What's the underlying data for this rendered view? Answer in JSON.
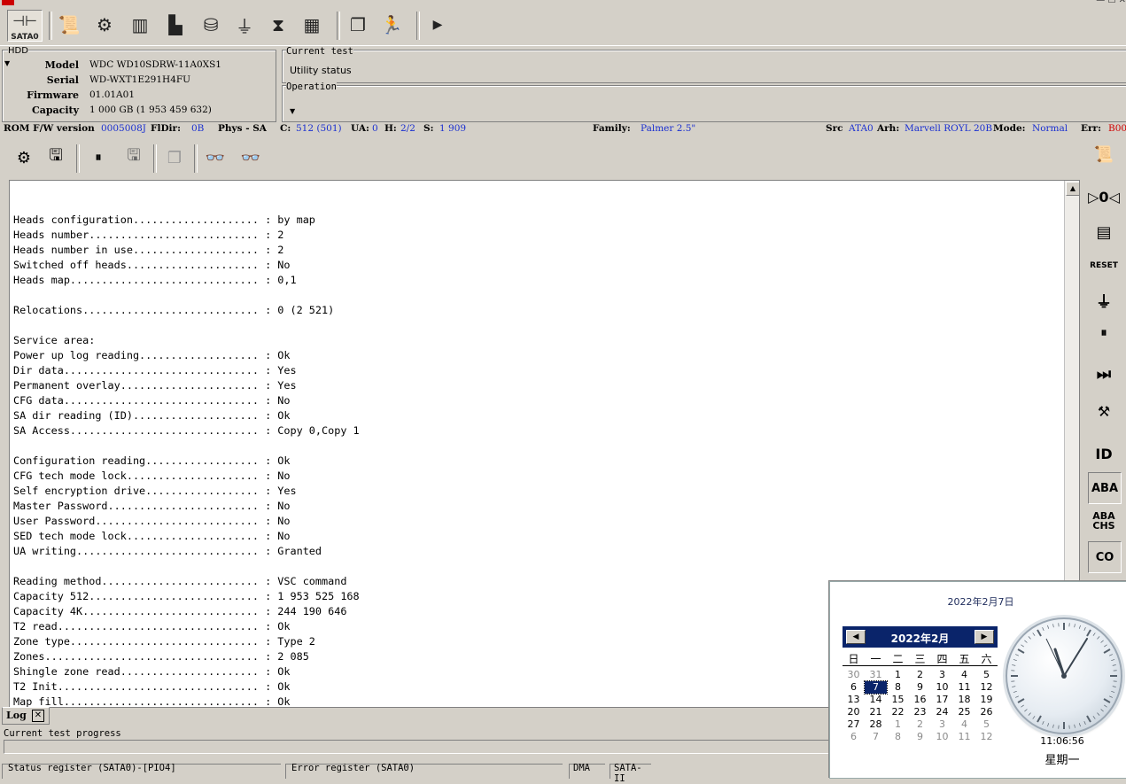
{
  "toolbar": {
    "sata_label": "SATA0"
  },
  "hdd": {
    "legend": "HDD",
    "rows": [
      {
        "label": "Model",
        "value": "WDC WD10SDRW-11A0XS1"
      },
      {
        "label": "Serial",
        "value": "WD-WXT1E291H4FU"
      },
      {
        "label": "Firmware",
        "value": "01.01A01"
      },
      {
        "label": "Capacity",
        "value": "1 000 GB (1 953 459 632)"
      }
    ]
  },
  "current_test": {
    "legend": "Current test",
    "value": "Utility status"
  },
  "operation": {
    "legend": "Operation",
    "value": ""
  },
  "infoline": {
    "rom_label": "ROM F/W version",
    "rom_value": "0005008J",
    "fldir_label": "FlDir:",
    "fldir_value": "0B",
    "phys_label": "Phys - SA",
    "c_label": "C:",
    "c_value": "512 (501)",
    "ua_label": "UA:",
    "ua_value": "0",
    "h_label": "H:",
    "h_value": "2/2",
    "s_label": "S:",
    "s_value": "1 909",
    "family_label": "Family:",
    "family_value": "Palmer 2.5\"",
    "src_label": "Src",
    "src_value": "ATA0",
    "arh_label": "Arh:",
    "arh_value": "Marvell ROYL 20B",
    "mode_label": "Mode:",
    "mode_value": "Normal",
    "err_label": "Err:",
    "err_value": "B00"
  },
  "report": [
    "",
    "Heads configuration.................... : by map",
    "Heads number........................... : 2",
    "Heads number in use.................... : 2",
    "Switched off heads..................... : No",
    "Heads map.............................. : 0,1",
    "",
    "Relocations............................ : 0 (2 521)",
    "",
    "Service area:",
    "Power up log reading................... : Ok",
    "Dir data............................... : Yes",
    "Permanent overlay...................... : Yes",
    "CFG data............................... : No",
    "SA dir reading (ID).................... : Ok",
    "SA Access.............................. : Copy 0,Copy 1",
    "",
    "Configuration reading.................. : Ok",
    "CFG tech mode lock..................... : No",
    "Self encryption drive.................. : Yes",
    "Master Password........................ : No",
    "User Password.......................... : No",
    "SED tech mode lock..................... : No",
    "UA writing............................. : Granted",
    "",
    "Reading method......................... : VSC command",
    "Capacity 512........................... : 1 953 525 168",
    "Capacity 4K............................ : 244 190 646",
    "T2 read................................ : Ok",
    "Zone type.............................. : Type 2",
    "Zones.................................. : 2 085",
    "Shingle zone read...................... : Ok",
    "T2 Init................................ : Ok",
    "Map fill............................... : Ok"
  ],
  "sidebar": {
    "id_label": "ID",
    "aba_label": "ABA",
    "abachs_label": "ABA CHS",
    "co_label": "CO"
  },
  "bottom": {
    "log_tab": "Log",
    "progress_label": "Current test progress",
    "status_register": "Status register (SATA0)-[PIO4]",
    "error_register": "Error register (SATA0)",
    "dma": "DMA",
    "sata": "SATA-II"
  },
  "calendar": {
    "date_text": "2022年2月7日",
    "month_title": "2022年2月",
    "weekdays": [
      "日",
      "一",
      "二",
      "三",
      "四",
      "五",
      "六"
    ],
    "days": [
      [
        "30",
        "31",
        "1",
        "2",
        "3",
        "4",
        "5"
      ],
      [
        "6",
        "7",
        "8",
        "9",
        "10",
        "11",
        "12"
      ],
      [
        "13",
        "14",
        "15",
        "16",
        "17",
        "18",
        "19"
      ],
      [
        "20",
        "21",
        "22",
        "23",
        "24",
        "25",
        "26"
      ],
      [
        "27",
        "28",
        "1",
        "2",
        "3",
        "4",
        "5"
      ],
      [
        "6",
        "7",
        "8",
        "9",
        "10",
        "11",
        "12"
      ]
    ],
    "gray_cells": [
      [
        0,
        0
      ],
      [
        0,
        1
      ],
      [
        4,
        2
      ],
      [
        4,
        3
      ],
      [
        4,
        4
      ],
      [
        4,
        5
      ],
      [
        4,
        6
      ],
      [
        5,
        0
      ],
      [
        5,
        1
      ],
      [
        5,
        2
      ],
      [
        5,
        3
      ],
      [
        5,
        4
      ],
      [
        5,
        5
      ],
      [
        5,
        6
      ]
    ],
    "selected_cell": [
      1,
      1
    ],
    "time": "11:06:56",
    "weekday_name": "星期一"
  }
}
